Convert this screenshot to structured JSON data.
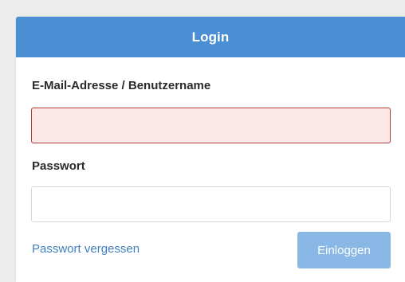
{
  "header": {
    "title": "Login"
  },
  "form": {
    "email_label": "E-Mail-Adresse / Benutzername",
    "email_value": "",
    "password_label": "Passwort",
    "password_value": "",
    "forgot_link": "Passwort vergessen",
    "submit_label": "Einloggen"
  },
  "colors": {
    "header_bg": "#4a8fd3",
    "email_error_bg": "#fde8e8",
    "email_error_border": "#b73a3a",
    "link": "#3f7fc0",
    "button_disabled_bg": "#8ab8e6"
  }
}
